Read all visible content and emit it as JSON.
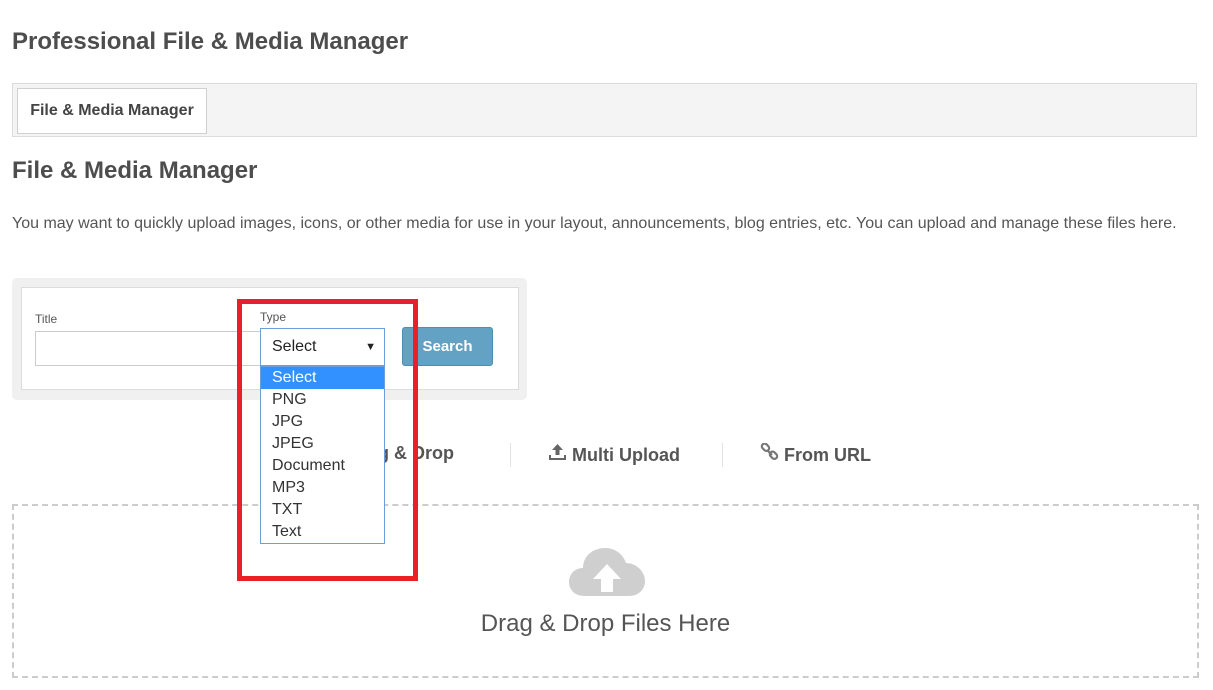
{
  "page": {
    "title": "Professional File & Media Manager"
  },
  "tabs": [
    {
      "label": "File & Media Manager",
      "active": true
    }
  ],
  "section": {
    "title": "File & Media Manager",
    "description": "You may want to quickly upload images, icons, or other media for use in your layout, announcements, blog entries, etc. You can upload and manage these files here."
  },
  "search": {
    "title_label": "Title",
    "title_value": "",
    "type_label": "Type",
    "type_selected": "Select",
    "type_options": [
      "Select",
      "PNG",
      "JPG",
      "JPEG",
      "Document",
      "MP3",
      "TXT",
      "Text"
    ],
    "button_label": "Search"
  },
  "upload_tabs": {
    "drag_drop": {
      "label": "ag & Drop",
      "icon": "hand-icon"
    },
    "multi_upload": {
      "label": "Multi Upload",
      "icon": "upload-icon"
    },
    "from_url": {
      "label": "From URL",
      "icon": "link-icon"
    }
  },
  "drop_zone": {
    "text": "Drag & Drop Files Here",
    "icon": "cloud-upload-icon"
  },
  "colors": {
    "search_button": "#64a2c4",
    "dropdown_highlight": "#3390ff",
    "annotation_box": "#e8202a"
  }
}
